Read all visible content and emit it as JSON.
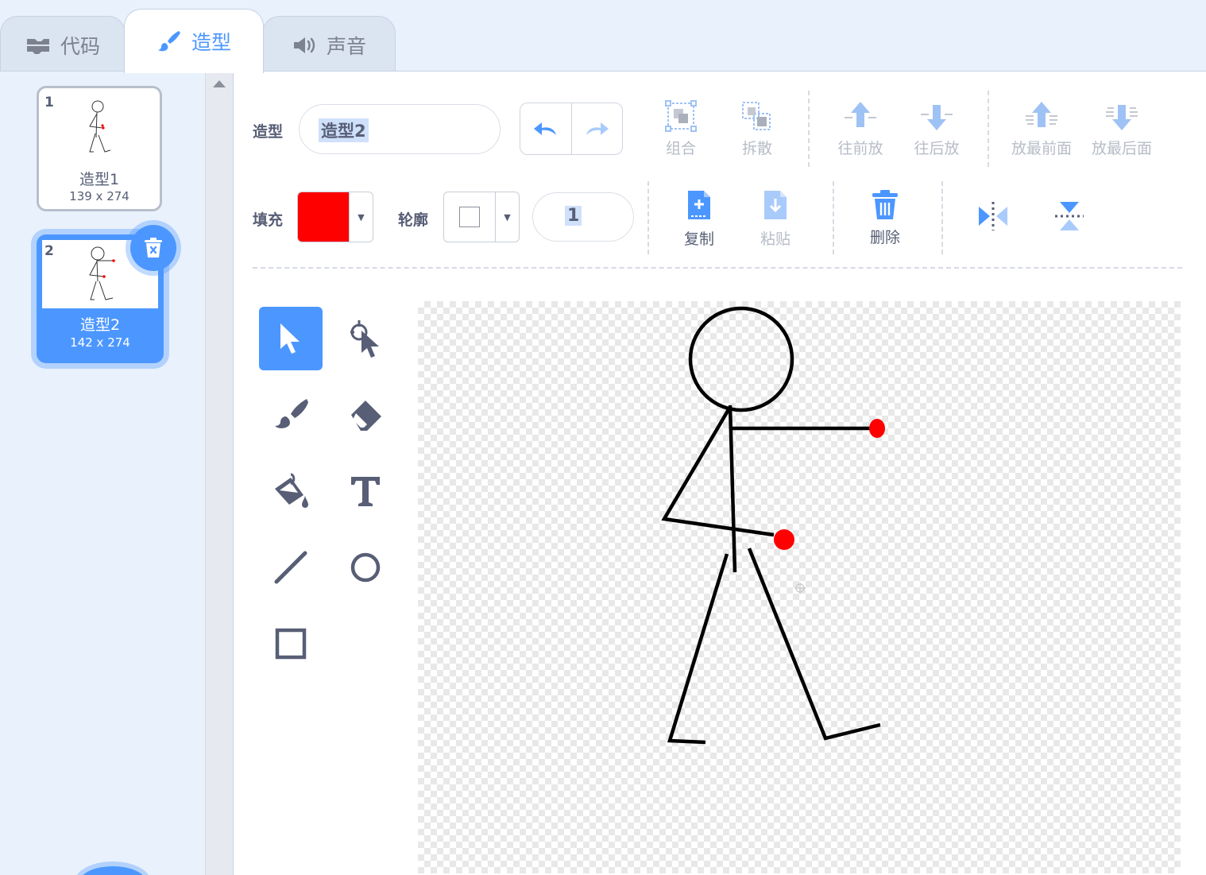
{
  "tabs": [
    {
      "label": "代码",
      "icon": "code-icon"
    },
    {
      "label": "造型",
      "icon": "brush-icon"
    },
    {
      "label": "声音",
      "icon": "speaker-icon"
    }
  ],
  "costumes": [
    {
      "number": "1",
      "name": "造型1",
      "size": "139 x 274",
      "selected": false
    },
    {
      "number": "2",
      "name": "造型2",
      "size": "142 x 274",
      "selected": true
    }
  ],
  "toolbar": {
    "costume_label": "造型",
    "costume_name": "造型2",
    "fill_label": "填充",
    "outline_label": "轮廓",
    "outline_width": "1",
    "fill_color": "#ff0000",
    "outline_color": "#ffffff",
    "group": "组合",
    "ungroup": "拆散",
    "forward": "往前放",
    "backward": "往后放",
    "front": "放最前面",
    "back": "放最后面",
    "copy": "复制",
    "paste": "粘贴",
    "delete": "删除"
  },
  "colors": {
    "accent": "#4c97ff",
    "text": "#575e75",
    "disabled": "#b7bcc7",
    "marker": "#ff0000"
  }
}
